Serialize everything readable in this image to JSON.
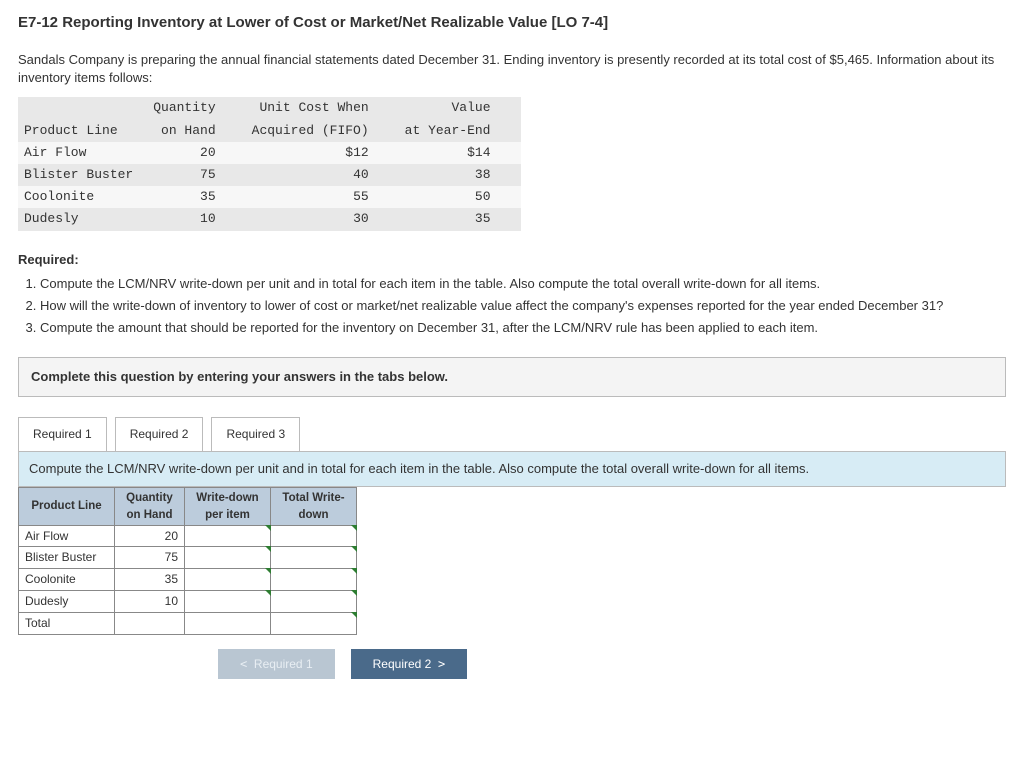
{
  "title": "E7-12 Reporting Inventory at Lower of Cost or Market/Net Realizable Value [LO 7-4]",
  "intro": "Sandals Company is preparing the annual financial statements dated December 31. Ending inventory is presently recorded at its total cost of $5,465. Information about its inventory items follows:",
  "info_table": {
    "headers": {
      "product": "Product Line",
      "qty_top": "Quantity",
      "qty_bot": "on Hand",
      "cost_top": "Unit Cost When",
      "cost_bot": "Acquired (FIFO)",
      "val_top": "Value",
      "val_bot": "at Year-End"
    },
    "rows": [
      {
        "product": "Air Flow",
        "qty": "20",
        "cost": "$12",
        "val": "$14"
      },
      {
        "product": "Blister Buster",
        "qty": "75",
        "cost": "40",
        "val": "38"
      },
      {
        "product": "Coolonite",
        "qty": "35",
        "cost": "55",
        "val": "50"
      },
      {
        "product": "Dudesly",
        "qty": "10",
        "cost": "30",
        "val": "35"
      }
    ]
  },
  "required_label": "Required:",
  "requirements": [
    "Compute the LCM/NRV write-down per unit and in total for each item in the table. Also compute the total overall write-down for all items.",
    "How will the write-down of inventory to lower of cost or market/net realizable value affect the company's expenses reported for the year ended December 31?",
    "Compute the amount that should be reported for the inventory on December 31, after the LCM/NRV rule has been applied to each item."
  ],
  "complete_instruction": "Complete this question by entering your answers in the tabs below.",
  "tabs": {
    "t1": "Required 1",
    "t2": "Required 2",
    "t3": "Required 3"
  },
  "prompt": "Compute the LCM/NRV write-down per unit and in total for each item in the table. Also compute the total overall write-down for all items.",
  "answer_table": {
    "headers": {
      "product": "Product Line",
      "qty_top": "Quantity",
      "qty_bot": "on Hand",
      "wpu_top": "Write-down",
      "wpu_bot": "per item",
      "twd_top": "Total Write-",
      "twd_bot": "down"
    },
    "rows": [
      {
        "product": "Air Flow",
        "qty": "20"
      },
      {
        "product": "Blister Buster",
        "qty": "75"
      },
      {
        "product": "Coolonite",
        "qty": "35"
      },
      {
        "product": "Dudesly",
        "qty": "10"
      },
      {
        "product": "Total",
        "qty": ""
      }
    ]
  },
  "nav": {
    "prev": "Required 1",
    "next": "Required 2"
  }
}
